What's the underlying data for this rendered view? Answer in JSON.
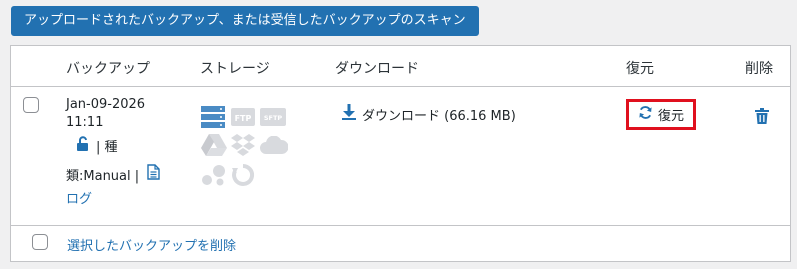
{
  "scan_button_label": "アップロードされたバックアップ、または受信したバックアップのスキャン",
  "table": {
    "headers": {
      "backup": "バックアップ",
      "storage": "ストレージ",
      "download": "ダウンロード",
      "restore": "復元",
      "delete": "削除"
    },
    "row": {
      "date": "Jan-09-2026",
      "time": "11:11",
      "type_prefix": "| 種",
      "type_value": "類:Manual |",
      "log_link": "ログ",
      "download_label": "ダウンロード (66.16 MB)",
      "restore_label": "復元"
    },
    "footer": {
      "delete_selected": "選択したバックアップを削除"
    }
  },
  "colors": {
    "accent": "#2271b1",
    "highlight_border": "#e0101e",
    "storage_icon_active": "#4a8bc4",
    "storage_icon_inactive": "#d8dade"
  },
  "icons": {
    "lock": "unlock-icon",
    "file": "document-icon",
    "download": "download-arrow-icon",
    "restore": "refresh-icon",
    "delete": "trash-icon",
    "storage": [
      "server-icon",
      "ftp-icon",
      "sftp-icon",
      "google-drive-icon",
      "dropbox-icon",
      "cloud-icon",
      "s3-icon",
      "backblaze-icon"
    ]
  }
}
